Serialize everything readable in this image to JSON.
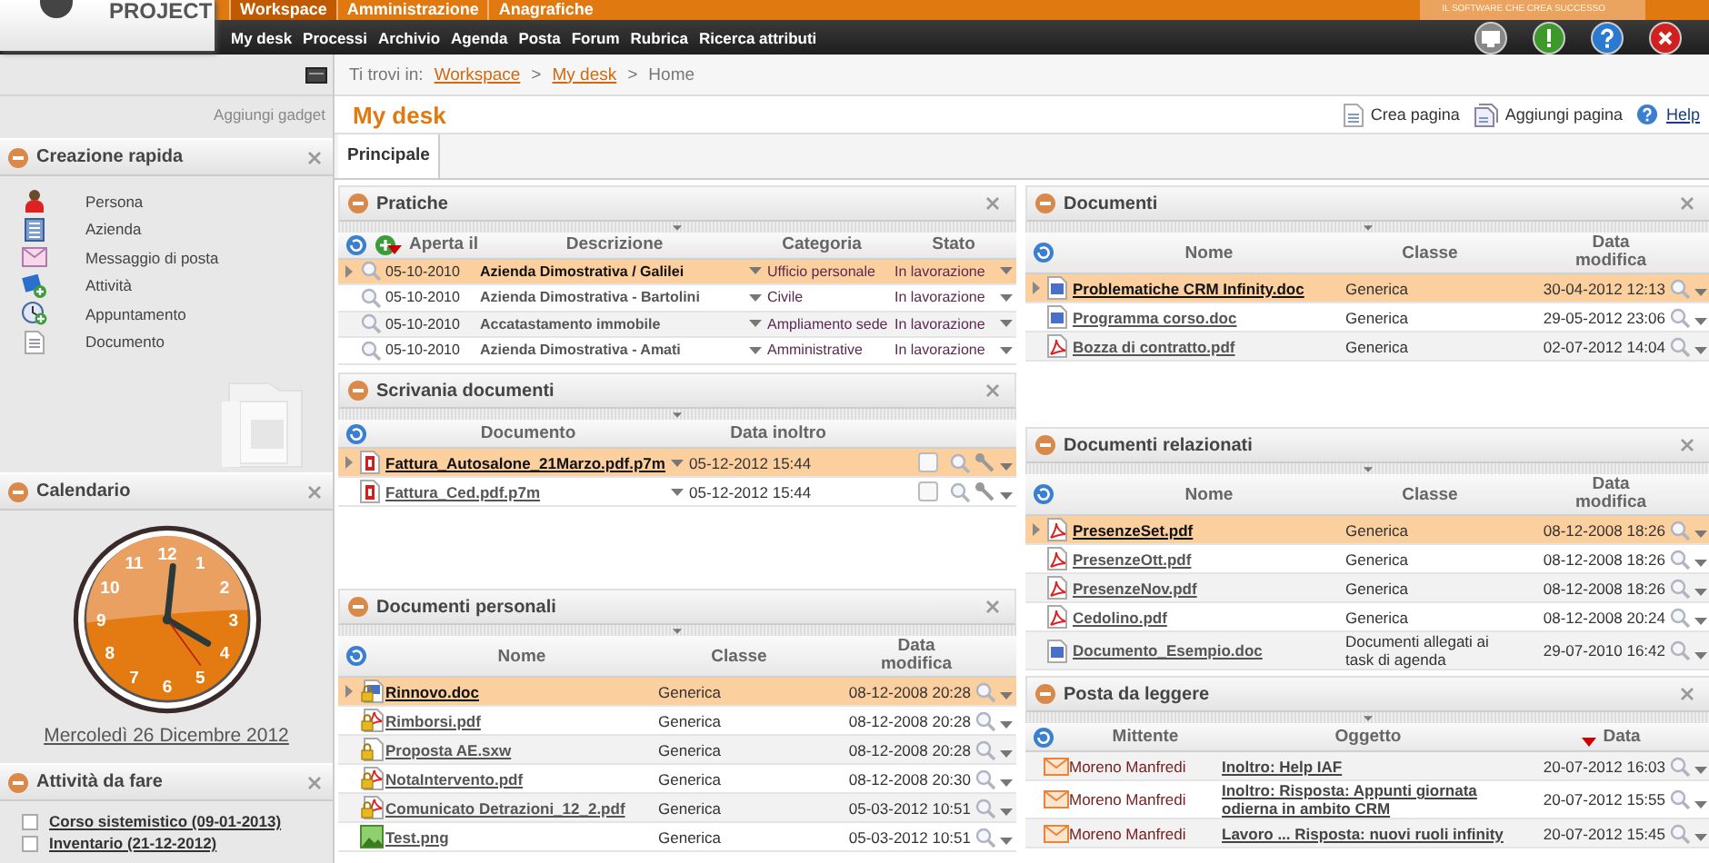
{
  "header": {
    "brand": "PROJECT",
    "slogan": "IL SOFTWARE CHE CREA SUCCESSO",
    "areas": [
      {
        "label": "Workspace",
        "selected": true
      },
      {
        "label": "Amministrazione",
        "selected": false
      },
      {
        "label": "Anagrafiche",
        "selected": false
      }
    ],
    "menu": [
      "My desk",
      "Processi",
      "Archivio",
      "Agenda",
      "Posta",
      "Forum",
      "Rubrica",
      "Ricerca attributi"
    ],
    "tools": [
      {
        "kind": "monitor"
      },
      {
        "kind": "alert"
      },
      {
        "kind": "help"
      },
      {
        "kind": "exit"
      }
    ]
  },
  "breadcrumb": {
    "prefix": "Ti trovi in:",
    "separator": ">",
    "items": [
      {
        "label": "Workspace",
        "link": true
      },
      {
        "label": "My desk",
        "link": true
      },
      {
        "label": "Home",
        "link": false
      }
    ]
  },
  "sidebar": {
    "add_gadget": "Aggiungi gadget",
    "gadgets": [
      {
        "kind": "quick_create",
        "title": "Creazione rapida",
        "items": [
          {
            "kind": "person",
            "label": "Persona"
          },
          {
            "kind": "company",
            "label": "Azienda"
          },
          {
            "kind": "message",
            "label": "Messaggio di posta"
          },
          {
            "kind": "activity",
            "label": "Attività"
          },
          {
            "kind": "appointment",
            "label": "Appuntamento"
          },
          {
            "kind": "document",
            "label": "Documento"
          }
        ]
      },
      {
        "kind": "calendar",
        "title": "Calendario",
        "dial": [
          "12",
          "11",
          "1",
          "10",
          "2",
          "9",
          "3",
          "8",
          "4",
          "7",
          "5",
          "6"
        ],
        "date": "Mercoledì 26 Dicembre 2012"
      },
      {
        "kind": "tasks",
        "title": "Attività da fare",
        "items": [
          {
            "label": "Corso sistemistico (09-01-2013)",
            "checked": false
          },
          {
            "label": "Inventario (21-12-2012)",
            "checked": false
          }
        ]
      }
    ]
  },
  "page": {
    "title": "My desk",
    "actions": [
      {
        "kind": "new",
        "label": "Crea pagina"
      },
      {
        "kind": "add",
        "label": "Aggiungi pagina"
      },
      {
        "kind": "help",
        "label": "Help"
      }
    ],
    "tabs": [
      {
        "label": "Principale",
        "selected": true
      }
    ]
  },
  "dashboard": {
    "columns": [
      {
        "widgets": [
          {
            "kind": "cases",
            "title": "Pratiche",
            "columns": [
              {
                "label": "Aperta il",
                "sorted": true
              },
              {
                "label": "Descrizione",
                "sorted": false
              },
              {
                "label": "Categoria",
                "sorted": false
              },
              {
                "label": "Stato",
                "sorted": false
              }
            ],
            "rows": [
              {
                "selected": true,
                "cells": [
                  "05-10-2010",
                  "Azienda Dimostrativa / Galilei",
                  "Ufficio personale",
                  "In lavorazione"
                ]
              },
              {
                "selected": false,
                "cells": [
                  "05-10-2010",
                  "Azienda Dimostrativa - Bartolini",
                  "Civile",
                  "In lavorazione"
                ]
              },
              {
                "selected": false,
                "cells": [
                  "05-10-2010",
                  "Accatastamento immobile",
                  "Ampliamento sede",
                  "In lavorazione"
                ]
              },
              {
                "selected": false,
                "cells": [
                  "05-10-2010",
                  "Azienda Dimostrativa - Amati",
                  "Amministrative",
                  "In lavorazione"
                ]
              }
            ]
          },
          {
            "kind": "desk",
            "title": "Scrivania documenti",
            "columns": [
              {
                "label": "Documento",
                "sorted": false
              },
              {
                "label": "Data inoltro",
                "sorted": false
              }
            ],
            "rows": [
              {
                "selected": true,
                "kind": "signed",
                "checked": false,
                "cells": [
                  "Fattura_Autosalone_21Marzo.pdf.p7m",
                  "05-12-2012 15:44"
                ]
              },
              {
                "selected": false,
                "kind": "signed",
                "checked": false,
                "cells": [
                  "Fattura_Ced.pdf.p7m",
                  "05-12-2012 15:44"
                ]
              }
            ]
          },
          {
            "kind": "documents",
            "title": "Documenti personali",
            "columns": [
              {
                "label": "Nome",
                "sorted": false
              },
              {
                "label": "Classe",
                "sorted": false
              },
              {
                "label": "Data modifica",
                "sorted": false
              }
            ],
            "rows": [
              {
                "selected": true,
                "kind": "locked-doc",
                "cells": [
                  "Rinnovo.doc",
                  "Generica",
                  "08-12-2008 20:28"
                ]
              },
              {
                "selected": false,
                "kind": "locked-pdf",
                "cells": [
                  "Rimborsi.pdf",
                  "Generica",
                  "08-12-2008 20:28"
                ]
              },
              {
                "selected": false,
                "kind": "locked",
                "cells": [
                  "Proposta AE.sxw",
                  "Generica",
                  "08-12-2008 20:28"
                ]
              },
              {
                "selected": false,
                "kind": "locked-pdf",
                "cells": [
                  "NotaIntervento.pdf",
                  "Generica",
                  "08-12-2008 20:30"
                ]
              },
              {
                "selected": false,
                "kind": "locked-pdf",
                "cells": [
                  "Comunicato Detrazioni_12_2.pdf",
                  "Generica",
                  "05-03-2012 10:51"
                ]
              },
              {
                "selected": false,
                "kind": "image",
                "cells": [
                  "Test.png",
                  "Generica",
                  "05-03-2012 10:51"
                ]
              }
            ]
          }
        ]
      },
      {
        "widgets": [
          {
            "kind": "documents",
            "title": "Documenti",
            "columns": [
              {
                "label": "Nome",
                "sorted": false
              },
              {
                "label": "Classe",
                "sorted": false
              },
              {
                "label": "Data modifica",
                "sorted": false
              }
            ],
            "rows": [
              {
                "selected": true,
                "kind": "doc",
                "cells": [
                  "Problematiche CRM Infinity.doc",
                  "Generica",
                  "30-04-2012 12:13"
                ]
              },
              {
                "selected": false,
                "kind": "doc",
                "cells": [
                  "Programma corso.doc",
                  "Generica",
                  "29-05-2012 23:06"
                ]
              },
              {
                "selected": false,
                "kind": "pdf",
                "cells": [
                  "Bozza di contratto.pdf",
                  "Generica",
                  "02-07-2012 14:04"
                ]
              }
            ]
          },
          {
            "kind": "documents",
            "title": "Documenti relazionati",
            "columns": [
              {
                "label": "Nome",
                "sorted": false
              },
              {
                "label": "Classe",
                "sorted": false
              },
              {
                "label": "Data modifica",
                "sorted": false
              }
            ],
            "rows": [
              {
                "selected": true,
                "kind": "pdf",
                "cells": [
                  "PresenzeSet.pdf",
                  "Generica",
                  "08-12-2008 18:26"
                ]
              },
              {
                "selected": false,
                "kind": "pdf",
                "cells": [
                  "PresenzeOtt.pdf",
                  "Generica",
                  "08-12-2008 18:26"
                ]
              },
              {
                "selected": false,
                "kind": "pdf",
                "cells": [
                  "PresenzeNov.pdf",
                  "Generica",
                  "08-12-2008 18:26"
                ]
              },
              {
                "selected": false,
                "kind": "pdf",
                "cells": [
                  "Cedolino.pdf",
                  "Generica",
                  "08-12-2008 20:24"
                ]
              },
              {
                "selected": false,
                "kind": "doc",
                "cells": [
                  "Documento_Esempio.doc",
                  "Documenti allegati ai task di agenda",
                  "29-07-2010 16:42"
                ]
              }
            ]
          },
          {
            "kind": "mail",
            "title": "Posta da leggere",
            "columns": [
              {
                "label": "Mittente",
                "sorted": false
              },
              {
                "label": "Oggetto",
                "sorted": false
              },
              {
                "label": "Data",
                "sorted": true
              }
            ],
            "rows": [
              {
                "selected": false,
                "cells": [
                  "Moreno Manfredi",
                  "Inoltro: Help IAF",
                  "20-07-2012 16:03"
                ]
              },
              {
                "selected": false,
                "cells": [
                  "Moreno Manfredi",
                  "Inoltro: Risposta: Appunti giornata odierna in ambito CRM",
                  "20-07-2012 15:55"
                ]
              },
              {
                "selected": false,
                "cells": [
                  "Moreno Manfredi",
                  "Lavoro ... Risposta: nuovi ruoli infinity",
                  "20-07-2012 15:45"
                ]
              }
            ]
          }
        ]
      }
    ]
  }
}
